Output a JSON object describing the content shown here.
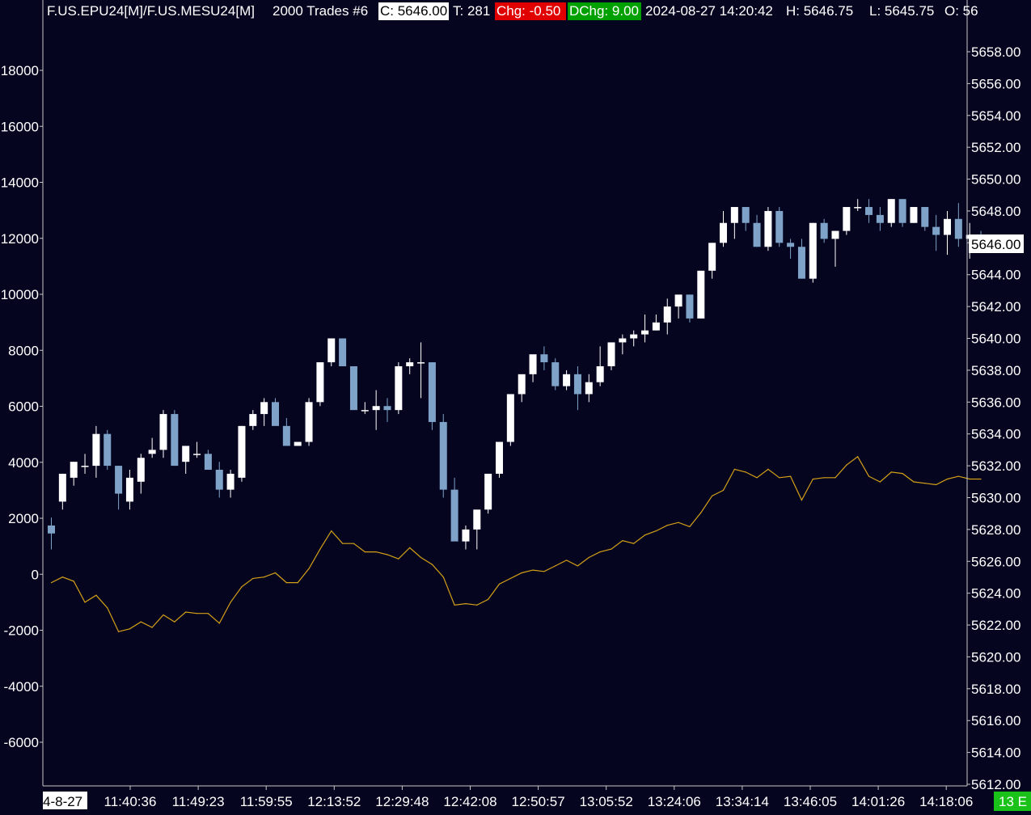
{
  "header": {
    "symbol": "F.US.EPU24[M]/F.US.MESU24[M]",
    "bar_type": "2000 Trades #6",
    "close": "C: 5646.00",
    "trades": "T: 281",
    "chg": "Chg: -0.50",
    "dchg": "DChg: 9.00",
    "timestamp": "2024-08-27 14:20:42",
    "high": "H: 5646.75",
    "low": "L: 5645.75",
    "open": "O: 56"
  },
  "colors": {
    "background": "#050520",
    "text": "#ffffff",
    "axis": "#c8c8c8",
    "up_candle": "#ffffff",
    "down_candle": "#7fa3c8",
    "spread_line": "#d4a017",
    "chg_bg": "#e00000",
    "dchg_bg": "#00a000",
    "close_bg": "#ffffff",
    "badge_bg": "#19c119"
  },
  "footer": {
    "badge": "13 E"
  },
  "chart_data": {
    "type": "line",
    "xlabel": "",
    "ylabel": "",
    "x_axis": {
      "first_label": "4-8-27",
      "tick_labels": [
        "11:40:36",
        "11:49:23",
        "11:59:55",
        "12:13:52",
        "12:29:48",
        "12:42:08",
        "12:50:57",
        "13:05:52",
        "13:24:06",
        "13:34:14",
        "13:46:05",
        "14:01:26",
        "14:18:06"
      ]
    },
    "left_axis": {
      "ylim": [
        -7200,
        20500
      ],
      "ticks": [
        18000,
        16000,
        14000,
        12000,
        10000,
        8000,
        6000,
        4000,
        2000,
        0,
        -2000,
        -4000,
        -6000
      ]
    },
    "right_axis": {
      "ylim": [
        5611.9,
        5660.1
      ],
      "ticks": [
        5658,
        5656,
        5654,
        5652,
        5650,
        5648,
        5646,
        5644,
        5642,
        5640,
        5638,
        5636,
        5634,
        5632,
        5630,
        5628,
        5626,
        5624,
        5622,
        5620,
        5618,
        5616,
        5614,
        5612
      ],
      "current_price_label": "5646.00",
      "current_price": 5646.0
    },
    "series": [
      {
        "type": "candlestick",
        "axis": "right",
        "ohlc": [
          [
            5628.25,
            5628.75,
            5626.75,
            5627.75
          ],
          [
            5629.75,
            5630.75,
            5629.25,
            5631.5
          ],
          [
            5631.25,
            5632.25,
            5630.75,
            5632.25
          ],
          [
            5632.0,
            5632.75,
            5631.5,
            5632.0
          ],
          [
            5632.0,
            5634.5,
            5631.25,
            5634.0
          ],
          [
            5634.0,
            5634.25,
            5631.75,
            5632.0
          ],
          [
            5632.0,
            5632.0,
            5629.25,
            5630.25
          ],
          [
            5629.75,
            5631.75,
            5629.25,
            5631.25
          ],
          [
            5631.0,
            5632.75,
            5630.25,
            5632.5
          ],
          [
            5632.75,
            5633.75,
            5632.5,
            5633.0
          ],
          [
            5633.0,
            5635.5,
            5632.5,
            5635.25
          ],
          [
            5635.25,
            5635.5,
            5632.25,
            5632.0
          ],
          [
            5632.25,
            5633.25,
            5631.5,
            5633.25
          ],
          [
            5632.75,
            5633.5,
            5632.5,
            5632.75
          ],
          [
            5632.75,
            5633.0,
            5632.0,
            5631.75
          ],
          [
            5631.75,
            5632.25,
            5630.0,
            5630.5
          ],
          [
            5630.5,
            5631.75,
            5630.0,
            5631.5
          ],
          [
            5631.25,
            5634.5,
            5631.0,
            5634.5
          ],
          [
            5634.5,
            5635.5,
            5634.25,
            5635.25
          ],
          [
            5635.25,
            5636.25,
            5634.5,
            5636.0
          ],
          [
            5636.0,
            5636.25,
            5634.75,
            5634.5
          ],
          [
            5634.5,
            5635.0,
            5634.25,
            5633.25
          ],
          [
            5633.25,
            5633.0,
            5633.0,
            5633.5
          ],
          [
            5633.5,
            5636.25,
            5633.25,
            5636.0
          ],
          [
            5636.0,
            5638.5,
            5635.75,
            5638.5
          ],
          [
            5638.5,
            5639.75,
            5638.25,
            5640.0
          ],
          [
            5640.0,
            5640.0,
            5638.25,
            5638.25
          ],
          [
            5638.25,
            5638.25,
            5636.0,
            5635.5
          ],
          [
            5635.5,
            5636.0,
            5635.25,
            5635.5
          ],
          [
            5635.5,
            5636.75,
            5634.25,
            5635.75
          ],
          [
            5635.75,
            5636.25,
            5634.75,
            5635.5
          ],
          [
            5635.5,
            5638.5,
            5635.25,
            5638.25
          ],
          [
            5638.25,
            5638.75,
            5637.75,
            5638.5
          ],
          [
            5638.5,
            5639.75,
            5636.25,
            5638.5
          ],
          [
            5638.5,
            5638.5,
            5634.25,
            5634.75
          ],
          [
            5634.75,
            5635.25,
            5630.0,
            5630.5
          ],
          [
            5630.5,
            5631.25,
            5627.5,
            5627.25
          ],
          [
            5627.25,
            5628.25,
            5626.75,
            5628.0
          ],
          [
            5628.0,
            5628.25,
            5626.75,
            5629.25
          ],
          [
            5629.25,
            5631.5,
            5629.0,
            5631.5
          ],
          [
            5631.5,
            5633.5,
            5631.25,
            5633.5
          ],
          [
            5633.5,
            5636.5,
            5633.25,
            5636.5
          ],
          [
            5636.5,
            5637.5,
            5636.0,
            5637.75
          ],
          [
            5637.75,
            5638.5,
            5637.25,
            5639.0
          ],
          [
            5639.0,
            5639.5,
            5638.0,
            5638.5
          ],
          [
            5638.5,
            5638.75,
            5636.75,
            5637.0
          ],
          [
            5637.0,
            5638.0,
            5636.75,
            5637.75
          ],
          [
            5637.75,
            5638.25,
            5635.5,
            5636.5
          ],
          [
            5636.5,
            5637.75,
            5636.0,
            5637.25
          ],
          [
            5637.25,
            5639.5,
            5637.0,
            5638.25
          ],
          [
            5638.25,
            5638.75,
            5638.0,
            5639.75
          ],
          [
            5639.75,
            5640.25,
            5639.0,
            5640.0
          ],
          [
            5640.0,
            5640.5,
            5639.5,
            5640.25
          ],
          [
            5640.25,
            5641.5,
            5639.75,
            5640.5
          ],
          [
            5640.5,
            5641.5,
            5640.5,
            5641.0
          ],
          [
            5641.0,
            5642.5,
            5640.25,
            5642.0
          ],
          [
            5642.0,
            5642.25,
            5641.25,
            5642.75
          ],
          [
            5642.75,
            5642.75,
            5641.0,
            5641.25
          ],
          [
            5641.25,
            5643.5,
            5641.25,
            5644.25
          ],
          [
            5644.25,
            5646.0,
            5643.75,
            5646.0
          ],
          [
            5646.0,
            5648.0,
            5645.75,
            5647.25
          ],
          [
            5647.25,
            5648.25,
            5646.25,
            5648.25
          ],
          [
            5648.25,
            5648.25,
            5646.75,
            5647.25
          ],
          [
            5647.25,
            5647.75,
            5645.75,
            5645.75
          ],
          [
            5645.75,
            5648.25,
            5645.5,
            5648.0
          ],
          [
            5648.0,
            5648.25,
            5645.75,
            5646.0
          ],
          [
            5646.0,
            5646.25,
            5645.0,
            5645.75
          ],
          [
            5645.75,
            5646.25,
            5643.75,
            5643.75
          ],
          [
            5643.75,
            5647.25,
            5643.5,
            5647.25
          ],
          [
            5647.25,
            5647.5,
            5646.0,
            5646.25
          ],
          [
            5646.25,
            5646.75,
            5644.5,
            5646.75
          ],
          [
            5646.75,
            5648.0,
            5646.5,
            5648.25
          ],
          [
            5648.25,
            5648.75,
            5648.0,
            5648.25
          ],
          [
            5648.25,
            5648.75,
            5647.25,
            5647.75
          ],
          [
            5647.75,
            5648.25,
            5646.75,
            5647.25
          ],
          [
            5647.25,
            5648.75,
            5647.0,
            5648.75
          ],
          [
            5648.75,
            5648.75,
            5647.0,
            5647.25
          ],
          [
            5647.25,
            5648.25,
            5647.25,
            5648.25
          ],
          [
            5648.25,
            5648.25,
            5646.75,
            5647.0
          ],
          [
            5647.0,
            5647.75,
            5645.5,
            5646.5
          ],
          [
            5646.5,
            5648.0,
            5645.25,
            5647.5
          ],
          [
            5647.5,
            5648.5,
            5645.75,
            5646.25
          ],
          [
            5646.25,
            5647.25,
            5645.0,
            5646.5
          ],
          [
            5646.5,
            5646.75,
            5645.75,
            5646.0
          ]
        ]
      },
      {
        "type": "line",
        "axis": "left",
        "color": "#d4a017",
        "values": [
          -300,
          -100,
          -250,
          -1000,
          -750,
          -1200,
          -2050,
          -1950,
          -1700,
          -1900,
          -1450,
          -1700,
          -1350,
          -1400,
          -1400,
          -1750,
          -1000,
          -450,
          -150,
          -100,
          50,
          -300,
          -300,
          200,
          900,
          1550,
          1100,
          1100,
          800,
          800,
          700,
          550,
          950,
          600,
          350,
          -100,
          -1100,
          -1050,
          -1100,
          -900,
          -350,
          -150,
          50,
          150,
          100,
          300,
          500,
          300,
          600,
          800,
          900,
          1200,
          1100,
          1400,
          1550,
          1750,
          1850,
          1700,
          2200,
          2800,
          3000,
          3750,
          3650,
          3450,
          3750,
          3450,
          3500,
          2650,
          3400,
          3450,
          3450,
          3900,
          4200,
          3500,
          3300,
          3650,
          3600,
          3300,
          3250,
          3200,
          3400,
          3500,
          3400,
          3400
        ]
      }
    ]
  }
}
